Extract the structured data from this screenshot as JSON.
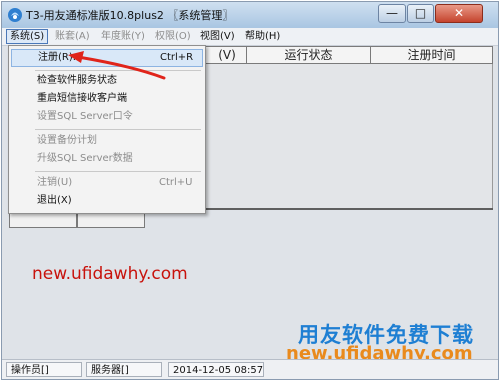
{
  "window": {
    "title": "T3-用友通标准版10.8plus2 〖系统管理〗",
    "controls": {
      "minimize": "—",
      "maximize": "□",
      "close": "✕"
    }
  },
  "menubar": {
    "items": [
      {
        "label": "系统(S)",
        "enabled": true,
        "active": true
      },
      {
        "label": "账套(A)",
        "enabled": false
      },
      {
        "label": "年度账(Y)",
        "enabled": false
      },
      {
        "label": "权限(O)",
        "enabled": false
      },
      {
        "label": "视图(V)",
        "enabled": true
      },
      {
        "label": "帮助(H)",
        "enabled": true
      }
    ]
  },
  "table": {
    "columns": [
      "(V)",
      "运行状态",
      "注册时间"
    ]
  },
  "dropdown": {
    "items": [
      {
        "label": "注册(R)...",
        "shortcut": "Ctrl+R",
        "enabled": true,
        "highlighted": true
      },
      {
        "label": "检查软件服务状态",
        "shortcut": "",
        "enabled": true
      },
      {
        "label": "重启短信接收客户端",
        "shortcut": "",
        "enabled": true
      },
      {
        "label": "设置SQL Server口令",
        "shortcut": "",
        "enabled": false
      },
      {
        "label": "设置备份计划",
        "shortcut": "",
        "enabled": false
      },
      {
        "label": "升级SQL Server数据",
        "shortcut": "",
        "enabled": false
      },
      {
        "label": "注销(U)",
        "shortcut": "Ctrl+U",
        "enabled": false
      },
      {
        "label": "退出(X)",
        "shortcut": "",
        "enabled": true
      }
    ]
  },
  "watermark": "new.ufidawhy.com",
  "brand": {
    "line1": "用友软件免费下载",
    "line2": "new.ufidawhy.com"
  },
  "statusbar": {
    "operator": "操作员[]",
    "server": "服务器[]",
    "datetime": "2014-12-05 08:57"
  },
  "colors": {
    "arrow": "#e0241a",
    "watermark": "#c8120c",
    "brand_blue": "#1e7fd3",
    "brand_orange": "#e98a1d"
  }
}
